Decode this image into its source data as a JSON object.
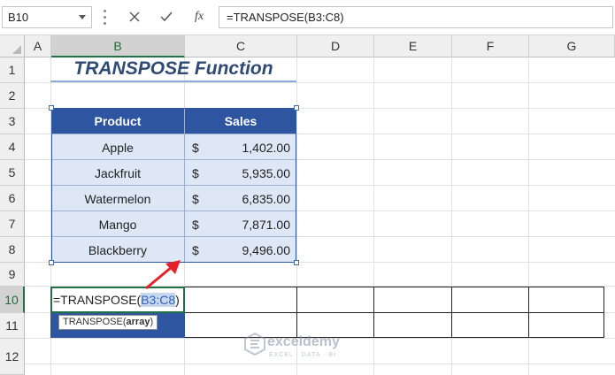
{
  "formula_bar": {
    "name_box": "B10",
    "formula": "=TRANSPOSE(B3:C8)",
    "fx_label": "fx"
  },
  "columns": [
    "A",
    "B",
    "C",
    "D",
    "E",
    "F",
    "G"
  ],
  "active_column": "B",
  "rows": [
    "1",
    "2",
    "3",
    "4",
    "5",
    "6",
    "7",
    "8",
    "9",
    "10",
    "11",
    "12"
  ],
  "active_row": "10",
  "title": "TRANSPOSE Function",
  "table": {
    "headers": [
      "Product",
      "Sales"
    ],
    "rows": [
      {
        "product": "Apple",
        "currency": "$",
        "sales": "1,402.00"
      },
      {
        "product": "Jackfruit",
        "currency": "$",
        "sales": "5,935.00"
      },
      {
        "product": "Watermelon",
        "currency": "$",
        "sales": "6,835.00"
      },
      {
        "product": "Mango",
        "currency": "$",
        "sales": "7,871.00"
      },
      {
        "product": "Blackberry",
        "currency": "$",
        "sales": "9,496.00"
      }
    ]
  },
  "editing": {
    "prefix": "=TRANSPOSE(",
    "ref": "B3:C8",
    "suffix": ")",
    "tooltip_func": "TRANSPOSE(",
    "tooltip_arg": "array",
    "tooltip_close": ")"
  },
  "watermark": {
    "brand": "exceldemy",
    "tagline": "EXCEL · DATA · BI"
  },
  "colors": {
    "table_header": "#2e55a0",
    "table_body": "#dde7f6",
    "title": "#2f4a73",
    "active_cell_border": "#217346",
    "annotation_arrow": "#e8202a"
  }
}
